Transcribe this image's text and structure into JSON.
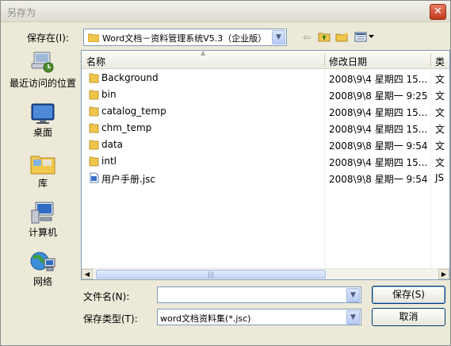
{
  "window": {
    "title": "另存为",
    "close_glyph": "✕"
  },
  "savein": {
    "label": "保存在(I):",
    "value": "Word文档－资料管理系统V5.3（企业版）"
  },
  "toolbar": {
    "back": "⇦",
    "up_icon": "folder-up-icon",
    "new_folder_icon": "new-folder-icon",
    "views_icon": "views-menu-icon"
  },
  "places": [
    {
      "label": "最近访问的位置",
      "icon": "recent-places-icon"
    },
    {
      "label": "桌面",
      "icon": "desktop-icon"
    },
    {
      "label": "库",
      "icon": "libraries-icon"
    },
    {
      "label": "计算机",
      "icon": "computer-icon"
    },
    {
      "label": "网络",
      "icon": "network-icon"
    }
  ],
  "filelist": {
    "columns": {
      "name": "名称",
      "date": "修改日期",
      "type": "类"
    },
    "rows": [
      {
        "name": "Background",
        "date": "2008\\9\\4 星期四 15...",
        "type": "文",
        "icon": "folder-icon"
      },
      {
        "name": "bin",
        "date": "2008\\9\\8 星期一 9:25",
        "type": "文",
        "icon": "folder-icon"
      },
      {
        "name": "catalog_temp",
        "date": "2008\\9\\4 星期四 15...",
        "type": "文",
        "icon": "folder-icon"
      },
      {
        "name": "chm_temp",
        "date": "2008\\9\\4 星期四 15...",
        "type": "文",
        "icon": "folder-icon"
      },
      {
        "name": "data",
        "date": "2008\\9\\8 星期一 9:54",
        "type": "文",
        "icon": "folder-icon"
      },
      {
        "name": "intl",
        "date": "2008\\9\\4 星期四 15...",
        "type": "文",
        "icon": "folder-icon"
      },
      {
        "name": "用户手册.jsc",
        "date": "2008\\9\\8 星期一 9:54",
        "type": "JS",
        "icon": "jsc-file-icon"
      }
    ]
  },
  "form": {
    "filename_label": "文件名(N):",
    "filename_value": "",
    "filetype_label": "保存类型(T):",
    "filetype_value": "word文档资料集(*.jsc)",
    "save_button": "保存(S)",
    "cancel_button": "取消"
  }
}
